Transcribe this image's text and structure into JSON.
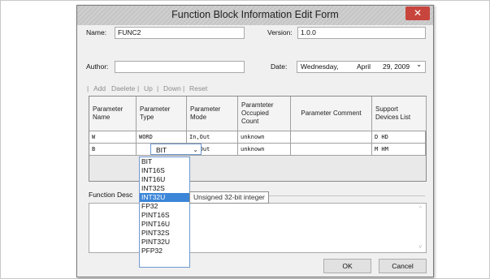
{
  "window": {
    "title": "Function Block Information Edit Form",
    "close_glyph": "✕"
  },
  "form": {
    "name_label": "Name:",
    "name_value": "FUNC2",
    "version_label": "Version:",
    "version_value": "1.0.0",
    "author_label": "Author:",
    "author_value": "",
    "date_label": "Date:",
    "date_day": "Wednesday,",
    "date_month": "April",
    "date_daynum": "29, 2009",
    "date_arrow": "⌄"
  },
  "toolbar": {
    "separator": "|",
    "add": "Add",
    "delete": "Daelete",
    "sep": "|",
    "up": "Up",
    "down": "Down",
    "reset": "Reset"
  },
  "table": {
    "headers": {
      "name": [
        "Parameter",
        "Name"
      ],
      "type": [
        "Parameter",
        "Type"
      ],
      "mode": [
        "Parameter",
        "Mode"
      ],
      "count": [
        "Paramteter",
        "Occupied",
        "Count"
      ],
      "comment": [
        "Parameter Comment"
      ],
      "devices": [
        "Support",
        "Devices List"
      ]
    },
    "rows": [
      {
        "name": "W",
        "type": "WORD",
        "mode": "In,Out",
        "count": "unknown",
        "comment": "",
        "devices": "D HD"
      },
      {
        "name": "B",
        "type": "BIT",
        "mode": "In,Out",
        "count": "unknown",
        "comment": "",
        "devices": "M HM"
      }
    ]
  },
  "dropdown": {
    "arrow": "⌄",
    "options": [
      "BIT",
      "INT16S",
      "INT16U",
      "INT32S",
      "INT32U",
      "FP32",
      "PINT16S",
      "PINT16U",
      "PINT32S",
      "PINT32U",
      "PFP32"
    ],
    "selected": "INT32U"
  },
  "tooltip": "Unsigned 32-bit integer",
  "function_desc_label": "Function Desc",
  "scroll": {
    "up": "^",
    "down": "v"
  },
  "buttons": {
    "ok": "OK",
    "cancel": "Cancel"
  },
  "colors": {
    "selection": "#3b86d8",
    "close": "#c8453d"
  }
}
